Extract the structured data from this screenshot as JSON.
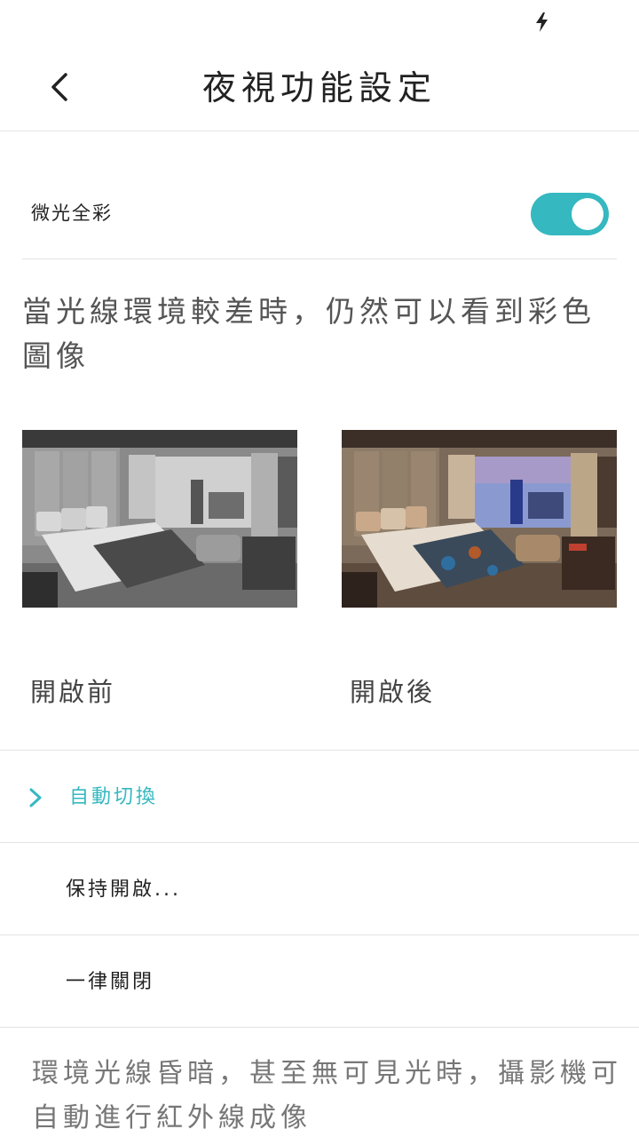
{
  "header": {
    "title": "夜視功能設定"
  },
  "toggle": {
    "label": "微光全彩",
    "on": true,
    "color": "#35b8c0"
  },
  "description": "當光線環境較差時，仍然可以看到彩色圖像",
  "images": {
    "before_caption": "開啟前",
    "after_caption": "開啟後"
  },
  "options": [
    {
      "label": "自動切換",
      "selected": true
    },
    {
      "label": "保持開啟..."
    },
    {
      "label": "一律關閉"
    }
  ],
  "footer_note": "環境光線昏暗，甚至無可見光時，攝影機可自動進行紅外線成像",
  "colors": {
    "accent": "#35b8c0",
    "divider": "#e3e3e3"
  },
  "icons": {
    "status": "bolt-icon",
    "back": "back-icon",
    "selected": "chevron-right-icon"
  }
}
